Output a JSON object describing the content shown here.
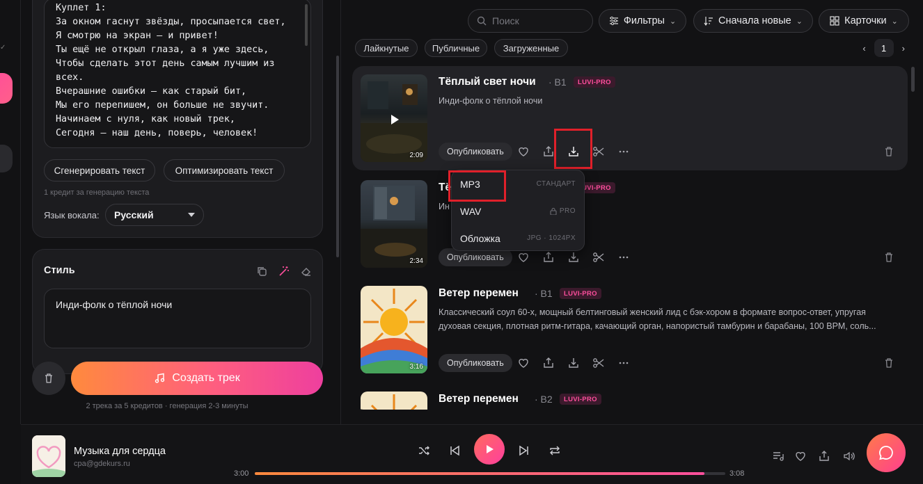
{
  "lyrics": {
    "lines": [
      "Куплет 1:",
      "За окном гаснут звёзды, просыпается свет,",
      "Я смотрю на экран — и привет!",
      "Ты ещё не открыл глаза, а я уже здесь,",
      "Чтобы сделать этот день самым лучшим из",
      "всех.",
      "Вчерашние ошибки — как старый бит,",
      "Мы его перепишем, он больше не звучит.",
      "Начинаем с нуля, как новый трек,",
      "Сегодня — наш день, поверь, человек!"
    ],
    "generate_label": "Сгенерировать текст",
    "optimize_label": "Оптимизировать текст",
    "credit_note": "1 кредит за генерацию текста",
    "vocal_lang_label": "Язык вокала:",
    "vocal_lang_value": "Русский"
  },
  "style": {
    "title": "Стиль",
    "text": "Инди-фолк о тёплой ночи"
  },
  "create": {
    "label": "Создать трек",
    "note": "2 трека за 5 кредитов · генерация 2-3 минуты"
  },
  "toolbar": {
    "search_placeholder": "Поиск",
    "filters": "Фильтры",
    "sort": "Сначала новые",
    "view": "Карточки"
  },
  "chips": [
    "Лайкнутые",
    "Публичные",
    "Загруженные"
  ],
  "pager": {
    "page": "1"
  },
  "tracks": [
    {
      "title": "Тёплый свет ночи",
      "version": "· B1",
      "badge": "LUVI-PRO",
      "desc": "Инди-фолк о тёплой ночи",
      "duration": "2:09",
      "publish": "Опубликовать"
    },
    {
      "title": "Тё",
      "version": "",
      "badge": "LUVI-PRO",
      "desc": "Ин",
      "duration": "2:34",
      "publish": "Опубликовать"
    },
    {
      "title": "Ветер перемен",
      "version": "· B1",
      "badge": "LUVI-PRO",
      "desc": "Классический соул 60-х, мощный белтинговый женский лид с бэк-хором в формате вопрос-ответ, упругая духовая секция, плотная ритм-гитара, качающий орган, напористый тамбурин и барабаны, 100 BPM, соль...",
      "duration": "3:16",
      "publish": "Опубликовать"
    },
    {
      "title": "Ветер перемен",
      "version": "· B2",
      "badge": "LUVI-PRO",
      "desc": "",
      "duration": "",
      "publish": ""
    }
  ],
  "download_menu": {
    "items": [
      {
        "label": "MP3",
        "meta": "СТАНДАРТ"
      },
      {
        "label": "WAV",
        "meta": "PRO"
      },
      {
        "label": "Обложка",
        "meta": "JPG · 1024PX"
      }
    ]
  },
  "player": {
    "title": "Музыка для сердца",
    "subtitle": "cpa@gdekurs.ru",
    "current": "3:00",
    "total": "3:08",
    "progress": 0.955
  },
  "colors": {
    "accent_pink": "#ff4f9d",
    "accent_orange": "#ff8a3d",
    "highlight_red": "#e0202a"
  }
}
